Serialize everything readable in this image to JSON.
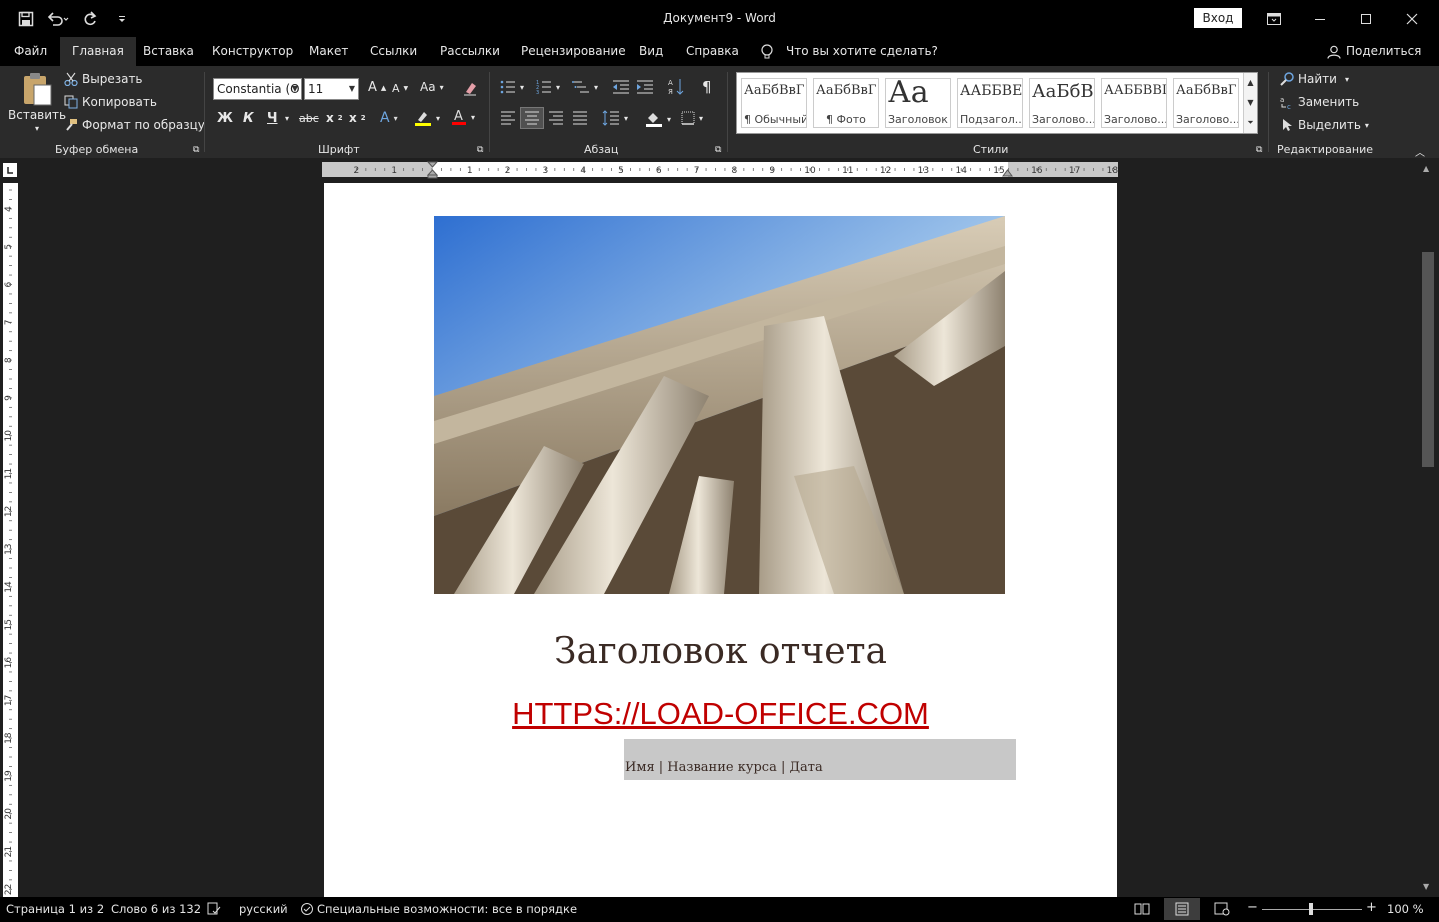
{
  "window": {
    "title": "Документ9  -  Word",
    "signin_label": "Вход"
  },
  "tabs": [
    {
      "label": "Файл"
    },
    {
      "label": "Главная"
    },
    {
      "label": "Вставка"
    },
    {
      "label": "Конструктор"
    },
    {
      "label": "Макет"
    },
    {
      "label": "Ссылки"
    },
    {
      "label": "Рассылки"
    },
    {
      "label": "Рецензирование"
    },
    {
      "label": "Вид"
    },
    {
      "label": "Справка"
    }
  ],
  "tell_me": "Что вы хотите сделать?",
  "share_label": "Поделиться",
  "clipboard": {
    "paste": "Вставить",
    "cut": "Вырезать",
    "copy": "Копировать",
    "format_painter": "Формат по образцу",
    "group": "Буфер обмена"
  },
  "font": {
    "family": "Constantia (О",
    "size": "11",
    "bold": "Ж",
    "italic": "К",
    "underline": "Ч",
    "strike": "abc",
    "group": "Шрифт"
  },
  "paragraph": {
    "group": "Абзац"
  },
  "styles": {
    "group": "Стили",
    "items": [
      {
        "preview": "АаБбВвГ",
        "name": "¶ Обычный"
      },
      {
        "preview": "АаБбВвГ",
        "name": "¶ Фото"
      },
      {
        "preview": "Аа",
        "name": "Заголовок"
      },
      {
        "preview": "ААББВЕ",
        "name": "Подзагол..."
      },
      {
        "preview": "АаБбВ",
        "name": "Заголово..."
      },
      {
        "preview": "ААББВВІ",
        "name": "Заголово..."
      },
      {
        "preview": "АаБбВвГ",
        "name": "Заголово..."
      }
    ]
  },
  "editing": {
    "group": "Редактирование",
    "find": "Найти",
    "replace": "Заменить",
    "select": "Выделить"
  },
  "ruler": {
    "h_ticks": [
      "2",
      "1",
      "1",
      "2",
      "3",
      "4",
      "5",
      "6",
      "7",
      "8",
      "9",
      "10",
      "11",
      "12",
      "13",
      "14",
      "15",
      "16",
      "17",
      "18"
    ],
    "v_ticks": [
      "4",
      "5",
      "6",
      "7",
      "8",
      "9",
      "10",
      "11",
      "12",
      "13",
      "14",
      "15",
      "16",
      "17",
      "18",
      "19",
      "20",
      "21",
      "22"
    ]
  },
  "document": {
    "title": "Заголовок отчета",
    "link": "HTTPS://LOAD-OFFICE.COM",
    "subtitle": "Имя | Название курса | Дата"
  },
  "status": {
    "page": "Страница 1 из 2",
    "words": "Слово 6 из 132",
    "language": "русский",
    "accessibility": "Специальные возможности: все в порядке",
    "zoom": "100 %"
  },
  "colors": {
    "accent_red": "#c00000",
    "title_brown": "#3a2a24",
    "ribbon_bg": "#2b2b2b"
  }
}
